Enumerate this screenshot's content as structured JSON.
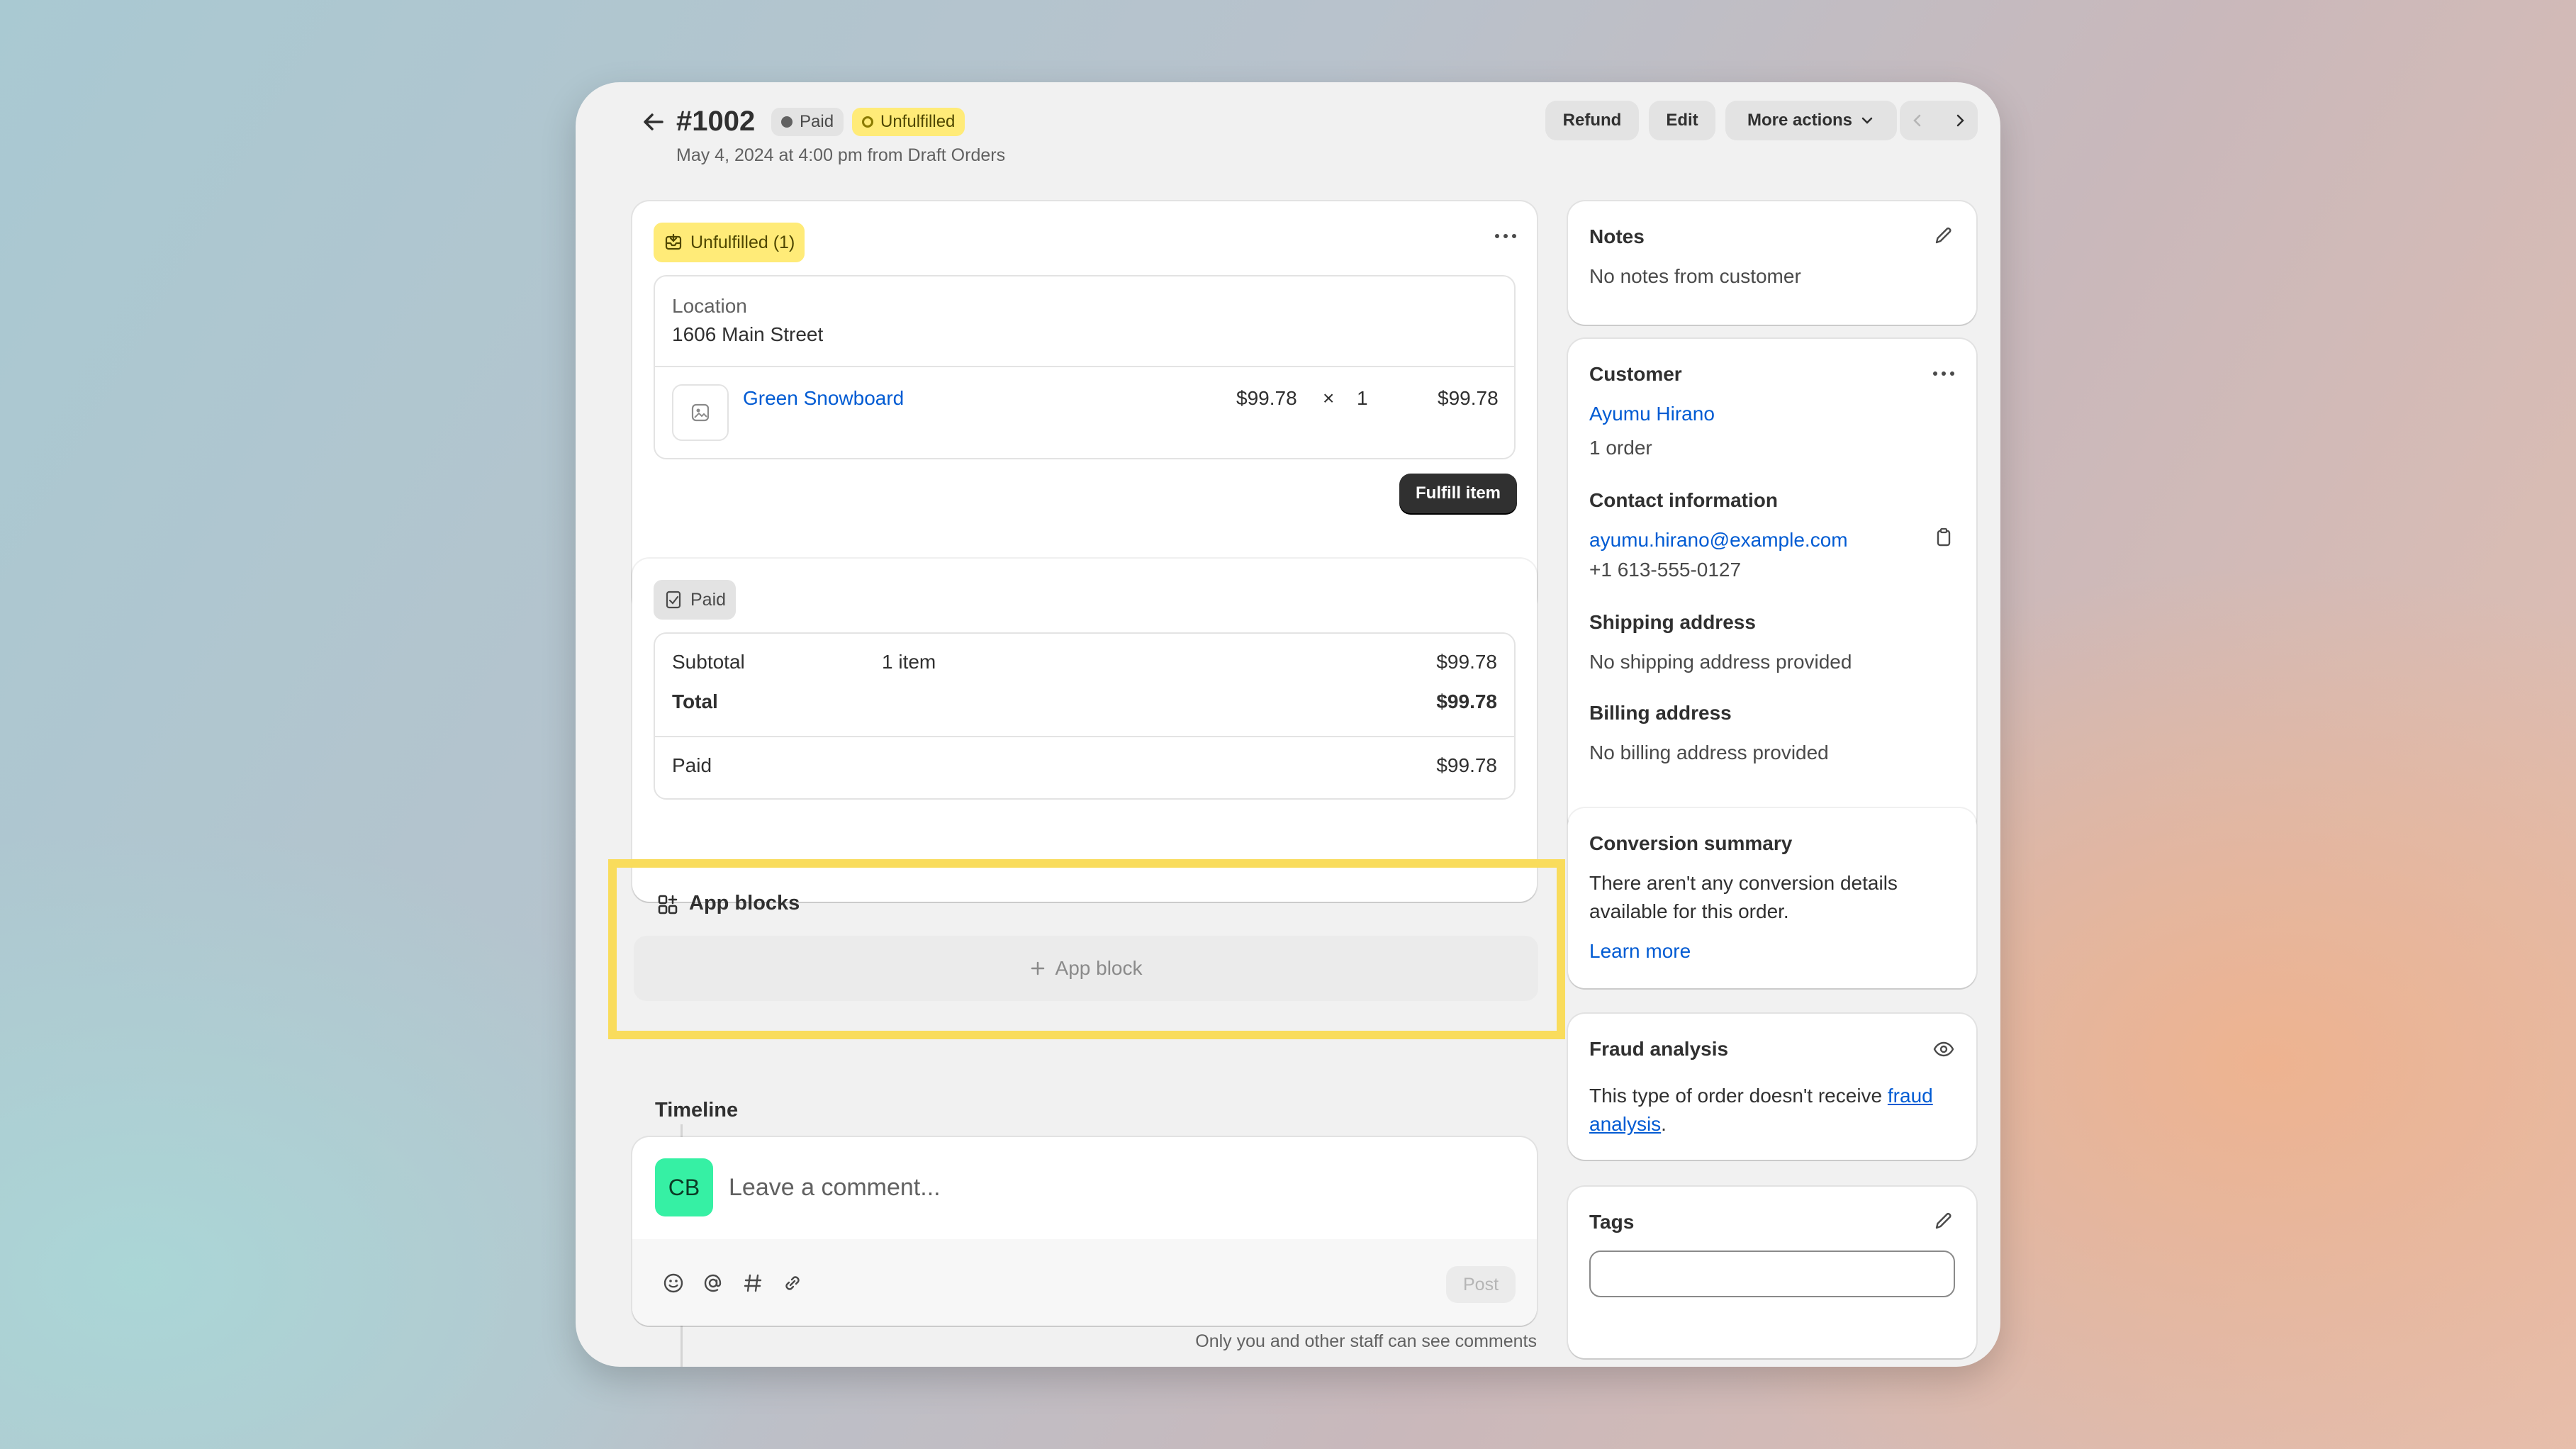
{
  "header": {
    "order_number": "#1002",
    "paid_badge": "Paid",
    "unfulfilled_badge": "Unfulfilled",
    "subtitle": "May 4, 2024 at 4:00 pm from Draft Orders",
    "refund_label": "Refund",
    "edit_label": "Edit",
    "more_actions_label": "More actions"
  },
  "fulfillment": {
    "badge": "Unfulfilled (1)",
    "location_label": "Location",
    "location_value": "1606 Main Street",
    "item_name": "Green Snowboard",
    "item_price": "$99.78",
    "item_times": "×",
    "item_qty": "1",
    "item_total": "$99.78",
    "fulfill_button": "Fulfill item"
  },
  "payment": {
    "badge": "Paid",
    "subtotal_label": "Subtotal",
    "subtotal_items": "1 item",
    "subtotal_value": "$99.78",
    "total_label": "Total",
    "total_value": "$99.78",
    "paid_label": "Paid",
    "paid_value": "$99.78"
  },
  "app_blocks": {
    "title": "App blocks",
    "add_label": "App block",
    "highlight_color": "#f9dc5c"
  },
  "timeline": {
    "title": "Timeline",
    "avatar_initials": "CB",
    "comment_placeholder": "Leave a comment...",
    "post_label": "Post",
    "footer_note": "Only you and other staff can see comments"
  },
  "notes": {
    "title": "Notes",
    "body": "No notes from customer"
  },
  "customer": {
    "title": "Customer",
    "name": "Ayumu Hirano",
    "orders": "1 order",
    "contact_title": "Contact information",
    "email": "ayumu.hirano@example.com",
    "phone": "+1 613-555-0127",
    "shipping_title": "Shipping address",
    "shipping_body": "No shipping address provided",
    "billing_title": "Billing address",
    "billing_body": "No billing address provided"
  },
  "conversion": {
    "title": "Conversion summary",
    "body_line1": "There aren't any conversion details",
    "body_line2": "available for this order.",
    "learn_more": "Learn more"
  },
  "fraud": {
    "title": "Fraud analysis",
    "body_prefix": "This type of order doesn't receive ",
    "link_line1": "fraud",
    "link_line2": "analysis",
    "body_suffix": "."
  },
  "tags": {
    "title": "Tags",
    "input_value": ""
  },
  "colors": {
    "unfulfilled_badge_bg": "#ffeb78",
    "avatar_bg": "#36f0a4",
    "link": "#005bd3"
  }
}
